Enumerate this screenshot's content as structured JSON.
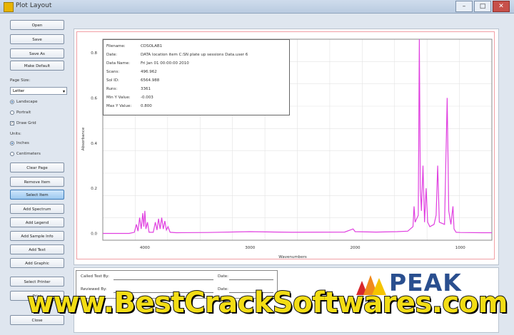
{
  "window": {
    "title": "Plot Layout",
    "min": "–",
    "max": "□",
    "close": "✕"
  },
  "left_panel": {
    "buttons_top": [
      "Open",
      "Save",
      "Save As",
      "Make Default"
    ],
    "page_size_label": "Page Size:",
    "page_size_value": "Letter",
    "orientation": {
      "landscape": "Landscape",
      "portrait": "Portrait",
      "landscape_selected": true
    },
    "draw_grid_label": "Draw Grid",
    "units_label": "Units:",
    "units": {
      "inches": "Inches",
      "centimeters": "Centimeters",
      "inches_selected": true
    },
    "buttons_bottom": [
      "Clear Page",
      "Remove Item",
      "Select Item",
      "Add Spectrum",
      "Add Legend",
      "Add Sample Info",
      "Add Text",
      "Add Graphic",
      "Select Printer",
      "Print",
      "Close"
    ],
    "active_button": "Select Item"
  },
  "info_box": {
    "rows": [
      {
        "k": "Filename:",
        "v": "CDSOLAB1"
      },
      {
        "k": "Date:",
        "v": "DATA location item C:SN plate up sessions Data.user 6"
      },
      {
        "k": "Data Name:",
        "v": "Fri Jan 01 00:00:00 2010"
      },
      {
        "k": "Scans:",
        "v": "496.962"
      },
      {
        "k": "Sol ID:",
        "v": "6564.988"
      },
      {
        "k": "Runs:",
        "v": "3361"
      },
      {
        "k": "Min Y Value:",
        "v": "-0.003"
      },
      {
        "k": "Max Y Value:",
        "v": "0.800"
      }
    ]
  },
  "chart_data": {
    "type": "line",
    "color": "#e040e0",
    "ylabel": "Absorbance",
    "xlabel": "Wavenumbers",
    "x_ticks": [
      "4000",
      "3000",
      "2000",
      "1000"
    ],
    "y_ticks": [
      "0.8",
      "0.6",
      "0.4",
      "0.2",
      "0.0"
    ],
    "xlim": [
      4400,
      700
    ],
    "ylim": [
      -0.03,
      0.86
    ],
    "points": [
      [
        4400,
        0.0
      ],
      [
        4150,
        0.0
      ],
      [
        4100,
        0.005
      ],
      [
        4080,
        0.04
      ],
      [
        4065,
        0.01
      ],
      [
        4050,
        0.07
      ],
      [
        4035,
        0.02
      ],
      [
        4020,
        0.09
      ],
      [
        4010,
        0.03
      ],
      [
        4000,
        0.1
      ],
      [
        3990,
        0.02
      ],
      [
        3975,
        0.05
      ],
      [
        3960,
        0.005
      ],
      [
        3920,
        0.005
      ],
      [
        3900,
        0.05
      ],
      [
        3885,
        0.015
      ],
      [
        3870,
        0.065
      ],
      [
        3855,
        0.02
      ],
      [
        3840,
        0.07
      ],
      [
        3825,
        0.02
      ],
      [
        3810,
        0.055
      ],
      [
        3795,
        0.015
      ],
      [
        3780,
        0.03
      ],
      [
        3760,
        0.005
      ],
      [
        3700,
        0.003
      ],
      [
        3400,
        0.004
      ],
      [
        3000,
        0.008
      ],
      [
        2600,
        0.005
      ],
      [
        2100,
        0.006
      ],
      [
        2020,
        0.02
      ],
      [
        2000,
        0.008
      ],
      [
        1800,
        0.006
      ],
      [
        1600,
        0.008
      ],
      [
        1500,
        0.01
      ],
      [
        1450,
        0.03
      ],
      [
        1440,
        0.12
      ],
      [
        1430,
        0.05
      ],
      [
        1420,
        0.06
      ],
      [
        1400,
        0.08
      ],
      [
        1390,
        0.86
      ],
      [
        1380,
        0.2
      ],
      [
        1370,
        0.1
      ],
      [
        1355,
        0.3
      ],
      [
        1340,
        0.05
      ],
      [
        1325,
        0.2
      ],
      [
        1310,
        0.05
      ],
      [
        1290,
        0.03
      ],
      [
        1250,
        0.04
      ],
      [
        1230,
        0.08
      ],
      [
        1215,
        0.3
      ],
      [
        1200,
        0.05
      ],
      [
        1150,
        0.04
      ],
      [
        1125,
        0.6
      ],
      [
        1110,
        0.1
      ],
      [
        1090,
        0.04
      ],
      [
        1070,
        0.12
      ],
      [
        1060,
        0.02
      ],
      [
        1040,
        0.005
      ],
      [
        1000,
        0.004
      ],
      [
        800,
        0.003
      ],
      [
        700,
        0.003
      ]
    ]
  },
  "sign_off": {
    "called_by": "Called Test By:",
    "reviewed_by": "Reviewed By:",
    "date_1": "Date:",
    "date_2": "Date:"
  },
  "logo": {
    "text": "PEAK"
  },
  "watermark": {
    "text": "www.BestCrackSoftwares.com"
  }
}
